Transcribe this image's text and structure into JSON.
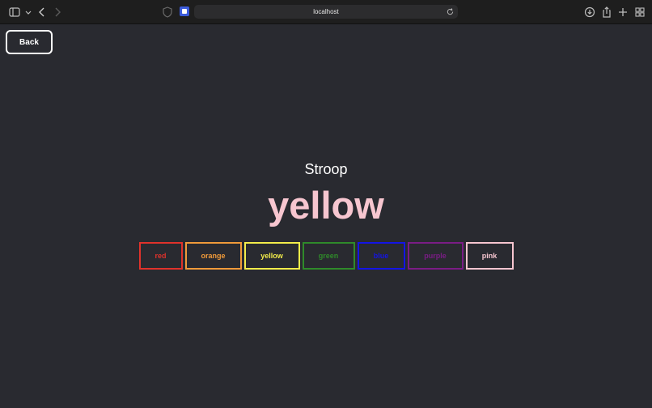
{
  "browser": {
    "url": "localhost"
  },
  "page": {
    "back_label": "Back",
    "title": "Stroop",
    "word": "yellow",
    "word_color": "#f7c6d0",
    "choices": [
      {
        "label": "red",
        "color": "#e0322b"
      },
      {
        "label": "orange",
        "color": "#f09a3a"
      },
      {
        "label": "yellow",
        "color": "#f2ec4a"
      },
      {
        "label": "green",
        "color": "#2f8a2a"
      },
      {
        "label": "blue",
        "color": "#1414e6"
      },
      {
        "label": "purple",
        "color": "#7b1c86"
      },
      {
        "label": "pink",
        "color": "#f7c6d0"
      }
    ]
  }
}
